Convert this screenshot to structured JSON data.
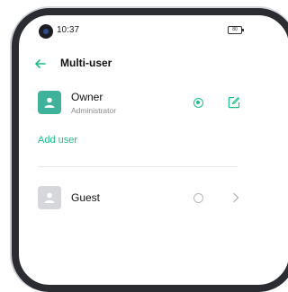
{
  "status_bar": {
    "time": "10:37",
    "battery": "80"
  },
  "header": {
    "title": "Multi-user"
  },
  "users": {
    "owner": {
      "name": "Owner",
      "role": "Administrator",
      "selected": true
    },
    "guest": {
      "name": "Guest",
      "selected": false
    }
  },
  "actions": {
    "add_user": "Add user"
  },
  "colors": {
    "accent": "#1bbf85",
    "owner_avatar": "#3fb29b",
    "guest_avatar": "#d5d7db"
  },
  "icons": {
    "back": "arrow-left-icon",
    "edit": "edit-icon",
    "chevron": "chevron-right-icon",
    "avatar": "person-icon"
  }
}
